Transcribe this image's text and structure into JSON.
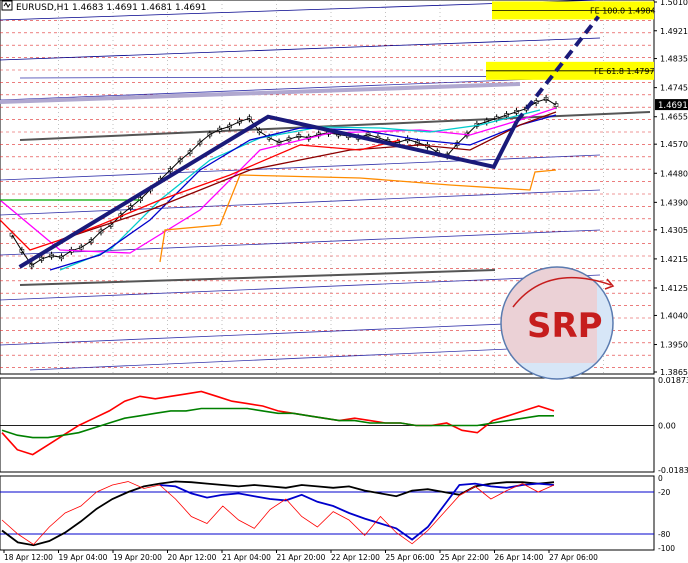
{
  "chart_data": {
    "type": "line",
    "title": "EURUSD,H1  1.4683 1.4691 1.4681 1.4691",
    "symbol": "EURUSD,H1",
    "ohlc": [
      "1.4683",
      "1.4691",
      "1.4681",
      "1.4691"
    ],
    "current_price": "1.4691",
    "ylim": [
      1.3865,
      1.501
    ],
    "grid": true,
    "price_ticks": [
      "1.5010",
      "1.4921",
      "1.4835",
      "1.4745",
      "1.4655",
      "1.4570",
      "1.4480",
      "1.4390",
      "1.4305",
      "1.4215",
      "1.4125",
      "1.4040",
      "1.3950",
      "1.3865"
    ],
    "x_labels": [
      "18 Apr 12:00",
      "19 Apr 04:00",
      "19 Apr 20:00",
      "20 Apr 12:00",
      "21 Apr 04:00",
      "21 Apr 20:00",
      "22 Apr 12:00",
      "25 Apr 06:00",
      "25 Apr 22:00",
      "26 Apr 14:00",
      "27 Apr 06:00"
    ],
    "annotations": [
      {
        "label": "FE 100.0 1.4984",
        "price": 1.4984
      },
      {
        "label": "FE 61.8 1.4797",
        "price": 1.4797
      }
    ],
    "zigzag": [
      {
        "t": 0.03,
        "price": 1.419
      },
      {
        "t": 0.41,
        "price": 1.4655
      },
      {
        "t": 0.755,
        "price": 1.45
      },
      {
        "t": 0.79,
        "price": 1.464
      }
    ],
    "projection": [
      {
        "t": 0.79,
        "price": 1.464
      },
      {
        "t": 0.915,
        "price": 1.4965
      }
    ],
    "close": [
      1.429,
      1.424,
      1.4195,
      1.4215,
      1.4225,
      1.422,
      1.424,
      1.425,
      1.427,
      1.43,
      1.432,
      1.435,
      1.4375,
      1.44,
      1.443,
      1.446,
      1.449,
      1.452,
      1.4545,
      1.4575,
      1.46,
      1.4615,
      1.4625,
      1.464,
      1.465,
      1.461,
      1.459,
      1.4575,
      1.4585,
      1.4595,
      1.459,
      1.46,
      1.4605,
      1.46,
      1.4595,
      1.459,
      1.46,
      1.459,
      1.458,
      1.4575,
      1.4585,
      1.4575,
      1.4565,
      1.4545,
      1.4535,
      1.457,
      1.46,
      1.463,
      1.464,
      1.465,
      1.466,
      1.467,
      1.468,
      1.47,
      1.471,
      1.4691
    ],
    "indicator_1": {
      "ticks": [
        "0.01873",
        "0.00",
        "-0.01835"
      ],
      "series": [
        {
          "color": "#ff0000",
          "values": [
            -0.003,
            -0.01,
            -0.012,
            -0.008,
            -0.004,
            0.0,
            0.003,
            0.006,
            0.01,
            0.012,
            0.011,
            0.012,
            0.013,
            0.014,
            0.012,
            0.01,
            0.009,
            0.008,
            0.006,
            0.005,
            0.004,
            0.003,
            0.002,
            0.003,
            0.002,
            0.001,
            0.001,
            0.0,
            0.0,
            0.001,
            -0.002,
            -0.003,
            0.002,
            0.004,
            0.006,
            0.008,
            0.006
          ]
        },
        {
          "color": "#008000",
          "values": [
            -0.002,
            -0.004,
            -0.005,
            -0.005,
            -0.004,
            -0.003,
            -0.001,
            0.001,
            0.003,
            0.004,
            0.005,
            0.006,
            0.006,
            0.007,
            0.007,
            0.007,
            0.007,
            0.006,
            0.005,
            0.005,
            0.004,
            0.003,
            0.002,
            0.002,
            0.001,
            0.001,
            0.001,
            0.0,
            0.0,
            0.0,
            0.0,
            0.0,
            0.001,
            0.002,
            0.003,
            0.004,
            0.004
          ]
        }
      ]
    },
    "indicator_2": {
      "ticks": [
        "0",
        "-20",
        "-80",
        "-100"
      ],
      "levels": [
        -20,
        -80
      ],
      "series": [
        {
          "color": "#000000",
          "values": [
            -75,
            -92,
            -96,
            -90,
            -78,
            -62,
            -44,
            -30,
            -20,
            -12,
            -8,
            -5,
            -6,
            -8,
            -10,
            -12,
            -10,
            -12,
            -14,
            -10,
            -12,
            -14,
            -12,
            -18,
            -22,
            -26,
            -18,
            -16,
            -20,
            -24,
            -12,
            -8,
            -6,
            -6,
            -8,
            -6
          ]
        },
        {
          "color": "#0000cc",
          "values": [
            null,
            null,
            null,
            null,
            null,
            null,
            null,
            null,
            null,
            null,
            -10,
            -12,
            -22,
            -28,
            -24,
            -22,
            -26,
            -30,
            -32,
            -24,
            -34,
            -40,
            -50,
            -58,
            -65,
            -72,
            -88,
            -70,
            -40,
            -10,
            -8,
            -12,
            -14,
            -10,
            -8,
            -10
          ]
        },
        {
          "color": "#ff0000",
          "values": [
            -60,
            -80,
            -95,
            -70,
            -50,
            -40,
            -20,
            -10,
            -5,
            -15,
            -10,
            -30,
            -55,
            -65,
            -40,
            -60,
            -72,
            -45,
            -30,
            -55,
            -70,
            -48,
            -60,
            -82,
            -55,
            -78,
            -94,
            -75,
            -50,
            -25,
            -12,
            -30,
            -18,
            -8,
            -20,
            -10
          ]
        }
      ]
    }
  }
}
